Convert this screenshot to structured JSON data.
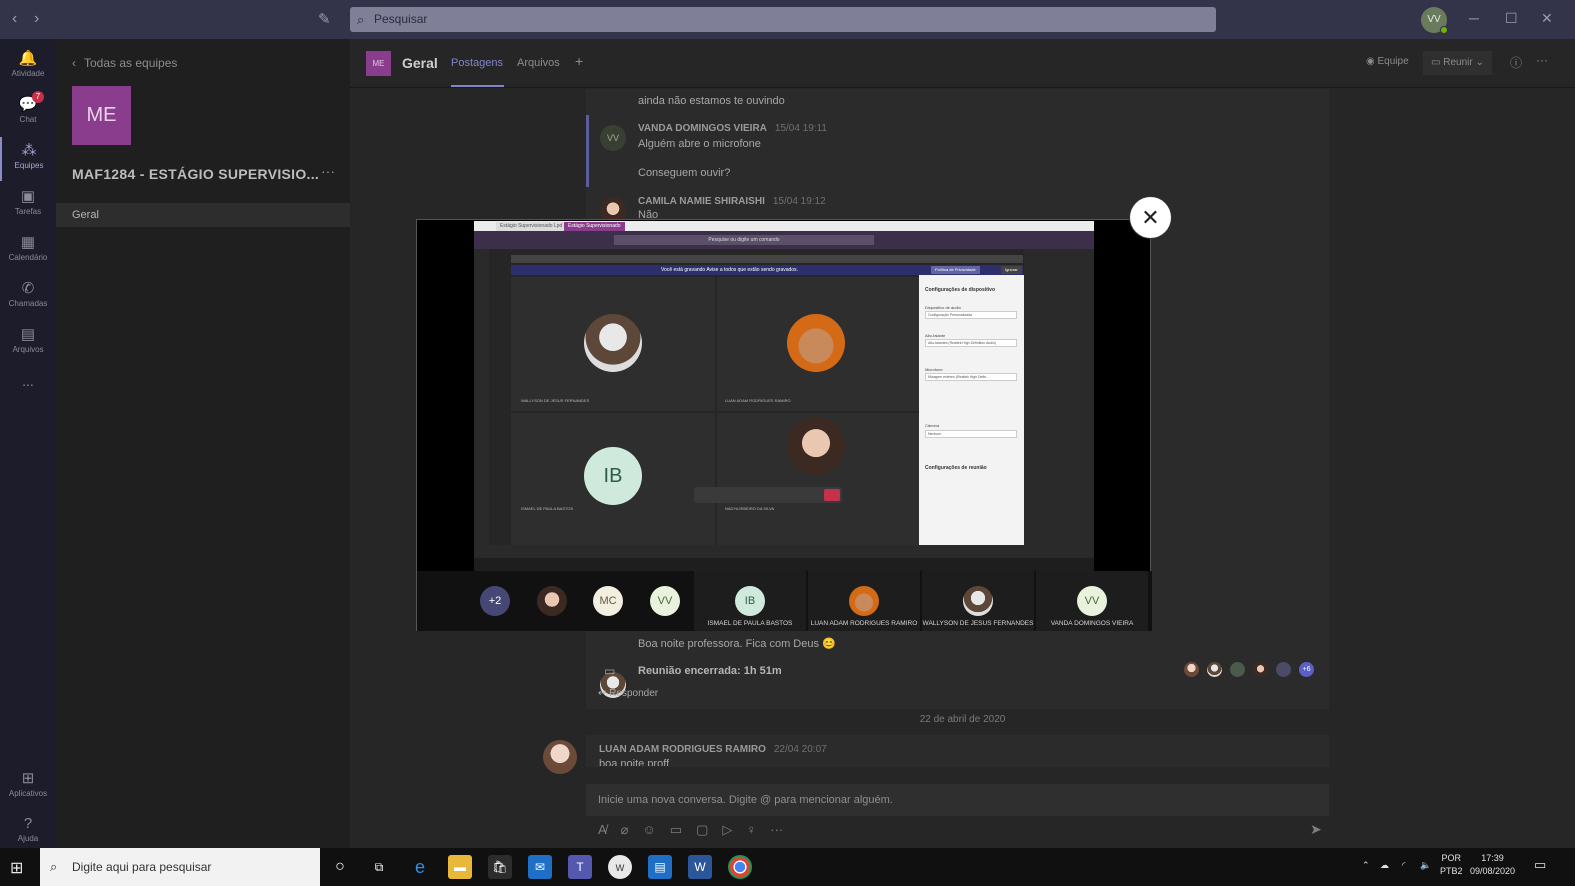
{
  "titlebar": {
    "search_placeholder": "Pesquisar",
    "user_initials": "VV"
  },
  "rail": {
    "items": [
      {
        "label": "Atividade",
        "icon": "bell-icon"
      },
      {
        "label": "Chat",
        "icon": "chat-icon",
        "badge": "7"
      },
      {
        "label": "Equipes",
        "icon": "teams-icon",
        "active": true
      },
      {
        "label": "Tarefas",
        "icon": "tasks-icon"
      },
      {
        "label": "Calendário",
        "icon": "calendar-icon"
      },
      {
        "label": "Chamadas",
        "icon": "phone-icon"
      },
      {
        "label": "Arquivos",
        "icon": "files-icon"
      }
    ],
    "more": "...",
    "apps_label": "Aplicativos",
    "help_label": "Ajuda"
  },
  "left_panel": {
    "back_label": "Todas as equipes",
    "team_initials": "ME",
    "team_name": "MAF1284 - ESTÁGIO SUPERVISIO...",
    "more": "···",
    "channel": "Geral"
  },
  "channel_header": {
    "logo": "ME",
    "title": "Geral",
    "tabs": [
      "Postagens",
      "Arquivos"
    ],
    "add": "+",
    "team_btn": "Equipe",
    "meet_btn": "Reunir",
    "more": "···"
  },
  "feed": {
    "line1": "ainda não estamos te ouvindo",
    "vv_initials": "VV",
    "vv_author": "VANDA DOMINGOS VIEIRA",
    "vv_time": "15/04 19:11",
    "vv_msg1": "Alguém abre o microfone",
    "vv_msg2": "Conseguem ouvir?",
    "camila_author": "CAMILA NAMIE SHIRAISHI",
    "camila_time": "15/04 19:12",
    "camila_msg": "Não",
    "goodnight": "Boa noite professora. Fica com Deus 😊",
    "meeting_ended": "Reunião encerrada: 1h 51m",
    "reply": "Responder",
    "participants_more": "+6",
    "date_sep": "22 de abril de 2020",
    "luan_author": "LUAN ADAM RODRIGUES RAMIRO",
    "luan_time": "22/04 20:07",
    "luan_msg": "boa noite proff"
  },
  "compose": {
    "placeholder": "Inicie uma nova conversa. Digite @ para mencionar alguém."
  },
  "overlay": {
    "close": "✕",
    "inner_tab1": "Estágio Supervisionado Lpd",
    "inner_tab2": "Estágio Supervisionado",
    "inner_search": "Pesquise ou digite um comando",
    "inner_rec": "Você está gravando  Avise a todos que estão sendo gravados.",
    "inner_policy": "Política de Privacidade",
    "inner_ignore": "Ignorar",
    "tile_names": [
      "WALLYSON DE JESUS FERNANDES",
      "LUAN ADAM RODRIGUES RAMIRO",
      "ISMAEL DE PAULA BASTOS",
      "NADYA RIBEIRO DA SILVA"
    ],
    "ib": "IB",
    "dev_title": "Configurações de dispositivo",
    "dev_audio": "Dispositivo de áudio",
    "dev_audio_val": "Configuração Personalizada",
    "dev_speaker": "Alto-falante",
    "dev_speaker_val": "Alto-falantes (Realtek High Definition Audio)",
    "dev_mic": "Microfone",
    "dev_mic_val": "Mixagem estéreo (Realtek High Defin...",
    "dev_camera": "Câmera",
    "dev_camera_val": "Nenhum",
    "dev_meeting": "Configurações de reunião",
    "strip_plus": "+2",
    "strip_mc": "MC",
    "strip_vv": "VV",
    "strip_names": [
      "ISMAEL DE PAULA BASTOS",
      "LUAN ADAM RODRIGUES RAMIRO",
      "WALLYSON DE JESUS FERNANDES",
      "VANDA DOMINGOS VIEIRA"
    ],
    "strip_ib": "IB",
    "strip_vv2": "VV"
  },
  "taskbar": {
    "search_placeholder": "Digite aqui para pesquisar",
    "lang1": "POR",
    "lang2": "PTB2",
    "time": "17:39",
    "date": "09/08/2020"
  }
}
